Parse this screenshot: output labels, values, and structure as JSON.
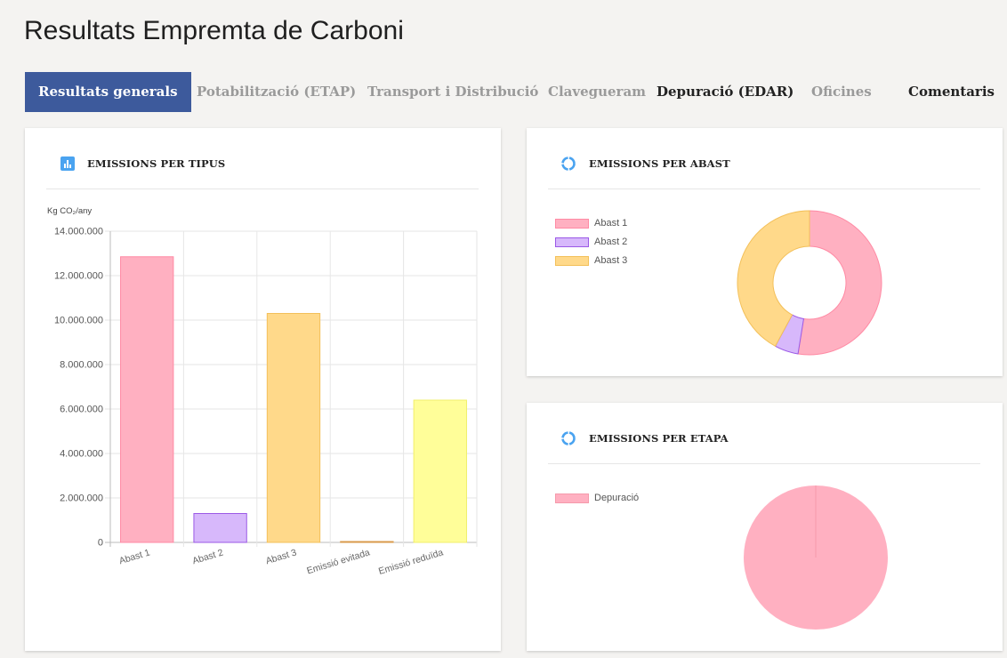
{
  "page": {
    "title": "Resultats Empremta de Carboni"
  },
  "tabs": [
    {
      "label": "Resultats generals",
      "active": true
    },
    {
      "label": "Potabilització (ETAP)"
    },
    {
      "label": "Transport i Distribució"
    },
    {
      "label": "Clavegueram"
    },
    {
      "label": "Depuració (EDAR)"
    },
    {
      "label": "Oficines"
    },
    {
      "label": "Comentaris"
    }
  ],
  "cards": {
    "tipus": {
      "title": "EMISSIONS PER TIPUS",
      "icon": "bar-chart-icon"
    },
    "abast": {
      "title": "EMISSIONS PER ABAST",
      "icon": "donut-chart-icon"
    },
    "etapa": {
      "title": "EMISSIONS PER ETAPA",
      "icon": "donut-chart-icon"
    }
  },
  "chart_data": [
    {
      "type": "bar",
      "title": "EMISSIONS PER TIPUS",
      "ylabel": "Kg CO₂/any",
      "categories": [
        "Abast 1",
        "Abast 2",
        "Abast 3",
        "Emissió evitada",
        "Emissió reduïda"
      ],
      "values": [
        12850000,
        1300000,
        10300000,
        0,
        6400000
      ],
      "colors": [
        "#ffb0c1",
        "#d7b8fb",
        "#ffd98a",
        "#f2c27a",
        "#fffe99"
      ],
      "borders": [
        "#ff8aa4",
        "#9b59e6",
        "#f3c05a",
        "#d89a4a",
        "#f0ef6a"
      ],
      "ylim": [
        0,
        14000000
      ],
      "yticks": [
        0,
        2000000,
        4000000,
        6000000,
        8000000,
        10000000,
        12000000,
        14000000
      ],
      "ytick_labels": [
        "0",
        "2.000.000",
        "4.000.000",
        "6.000.000",
        "8.000.000",
        "10.000.000",
        "12.000.000",
        "14.000.000"
      ],
      "grid": true
    },
    {
      "type": "pie",
      "variant": "doughnut",
      "title": "EMISSIONS PER ABAST",
      "categories": [
        "Abast 1",
        "Abast 2",
        "Abast 3"
      ],
      "values": [
        12850000,
        1300000,
        10300000
      ],
      "colors": [
        "#ffb0c1",
        "#d7b8fb",
        "#ffd98a"
      ],
      "borders": [
        "#ff8aa4",
        "#9b59e6",
        "#f3c05a"
      ],
      "legend": "left"
    },
    {
      "type": "pie",
      "title": "EMISSIONS PER ETAPA",
      "categories": [
        "Depuració"
      ],
      "values": [
        1
      ],
      "colors": [
        "#ffb0c1"
      ],
      "borders": [
        "#f59aab"
      ],
      "legend": "left"
    }
  ]
}
